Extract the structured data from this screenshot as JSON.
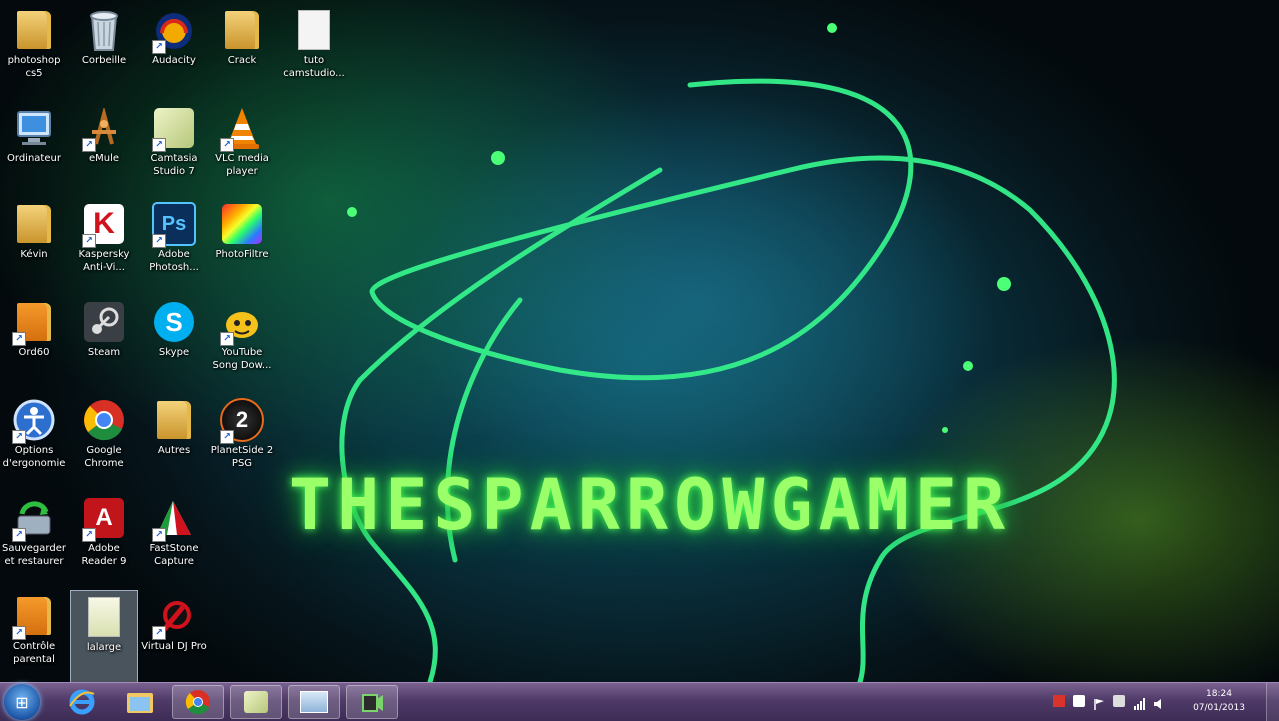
{
  "wallpaper": {
    "title": "THESPARROWGAMER"
  },
  "desktop": {
    "icons": [
      {
        "label": "photoshop cs5"
      },
      {
        "label": "Corbeille"
      },
      {
        "label": "Audacity"
      },
      {
        "label": "Crack"
      },
      {
        "label": "tuto camstudio..."
      },
      {
        "label": "Ordinateur"
      },
      {
        "label": "eMule"
      },
      {
        "label": "Camtasia Studio 7"
      },
      {
        "label": "VLC media player"
      },
      {
        "label": "Kévin"
      },
      {
        "label": "Kaspersky Anti-Vi..."
      },
      {
        "label": "Adobe Photosh..."
      },
      {
        "label": "PhotoFiltre"
      },
      {
        "label": "Ord60"
      },
      {
        "label": "Steam"
      },
      {
        "label": "Skype"
      },
      {
        "label": "YouTube Song Dow..."
      },
      {
        "label": "Options d'ergonomie"
      },
      {
        "label": "Google Chrome"
      },
      {
        "label": "Autres"
      },
      {
        "label": "PlanetSide 2 PSG"
      },
      {
        "label": "Sauvegarder et restaurer"
      },
      {
        "label": "Adobe Reader 9"
      },
      {
        "label": "FastStone Capture"
      },
      {
        "label": "Contrôle parental"
      },
      {
        "label": "lalarge"
      },
      {
        "label": "Virtual DJ Pro"
      }
    ]
  },
  "taskbar": {
    "start_symbol": "⊞",
    "pinned": [
      "Internet Explorer",
      "Windows Explorer",
      "Google Chrome",
      "Camtasia Studio",
      "Screen recorder",
      "Virtual camera"
    ],
    "clock": {
      "time": "18:24",
      "date": "07/01/2013"
    }
  },
  "colors": {
    "accent_green": "#9bff6a",
    "taskbar": "#4f3a68"
  }
}
